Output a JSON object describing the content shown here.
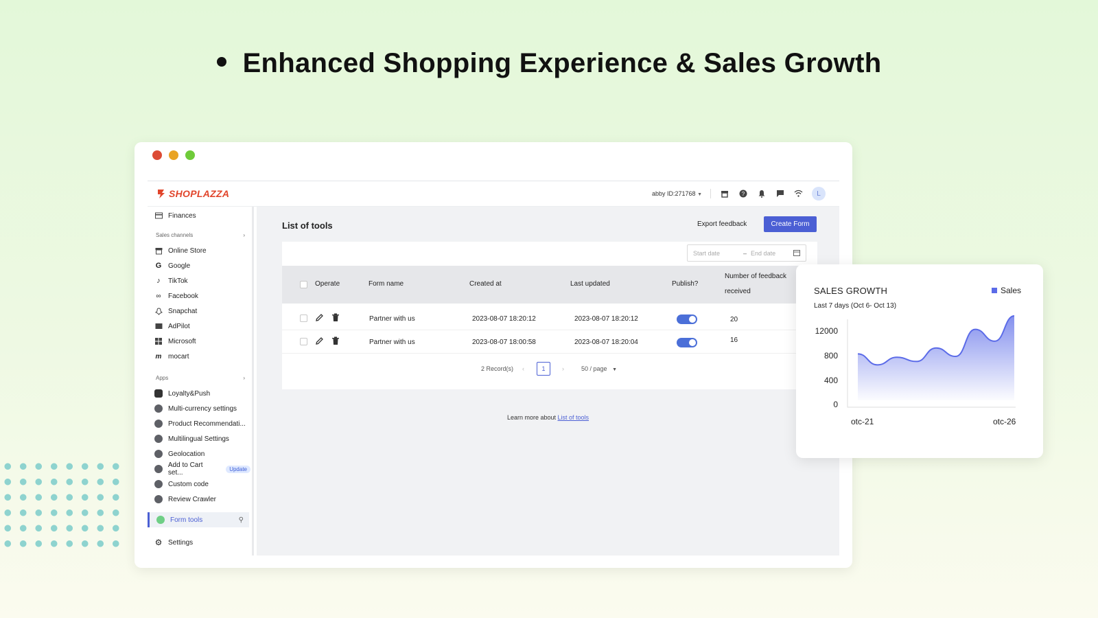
{
  "headline": "Enhanced Shopping Experience & Sales Growth",
  "window": {
    "traffic_lights": [
      "#dc4b35",
      "#e9a323",
      "#6fcb3a"
    ]
  },
  "topbar": {
    "logo": "SHOPLAZZA",
    "account": "abby ID:271768",
    "avatar_letter": "L"
  },
  "sidebar": {
    "finances": "Finances",
    "sales_channels_label": "Sales channels",
    "channels": [
      "Online Store",
      "Google",
      "TikTok",
      "Facebook",
      "Snapchat",
      "AdPilot",
      "Microsoft",
      "mocart"
    ],
    "apps_label": "Apps",
    "apps": [
      "Loyalty&Push",
      "Multi-currency settings",
      "Product Recommendati...",
      "Multilingual Settings",
      "Geolocation",
      "Add to Cart set...",
      "Custom code",
      "Review Crawler"
    ],
    "update_badge": "Update",
    "active": "Form tools",
    "settings": "Settings"
  },
  "main": {
    "title": "List of tools",
    "export": "Export feedback",
    "create": "Create Form",
    "start_date_placeholder": "Start date",
    "end_date_placeholder": "End date",
    "headers": {
      "operate": "Operate",
      "form_name": "Form name",
      "created_at": "Created at",
      "last_updated": "Last updated",
      "publish": "Publish?",
      "feedback_l1": "Number of feedback",
      "feedback_l2": "received"
    },
    "rows": [
      {
        "name": "Partner with us",
        "created": "2023-08-07 18:20:12",
        "updated": "2023-08-07 18:20:12",
        "published": true,
        "count": "20"
      },
      {
        "name": "Partner with us",
        "created": "2023-08-07 18:00:58",
        "updated": "2023-08-07 18:20:04",
        "published": true,
        "count": "16"
      }
    ],
    "records": "2 Record(s)",
    "page": "1",
    "per_page": "50 / page",
    "learn_prefix": "Learn more about",
    "learn_link": "List of tools"
  },
  "chart_card": {
    "title": "SALES GROWTH",
    "subtitle": "Last 7 days (Oct 6- Oct 13)",
    "legend": "Sales",
    "color": "#5b6be8"
  },
  "chart_data": {
    "type": "area",
    "title": "SALES GROWTH",
    "subtitle": "Last 7 days (Oct 6- Oct 13)",
    "yticks": [
      "12000",
      "800",
      "400",
      "0"
    ],
    "xticks": [
      "otc-21",
      "otc-26"
    ],
    "legend": "top-right",
    "series": [
      {
        "name": "Sales",
        "values": [
          0.55,
          0.42,
          0.51,
          0.46,
          0.62,
          0.52,
          0.84,
          0.7,
          1.0
        ]
      }
    ]
  }
}
